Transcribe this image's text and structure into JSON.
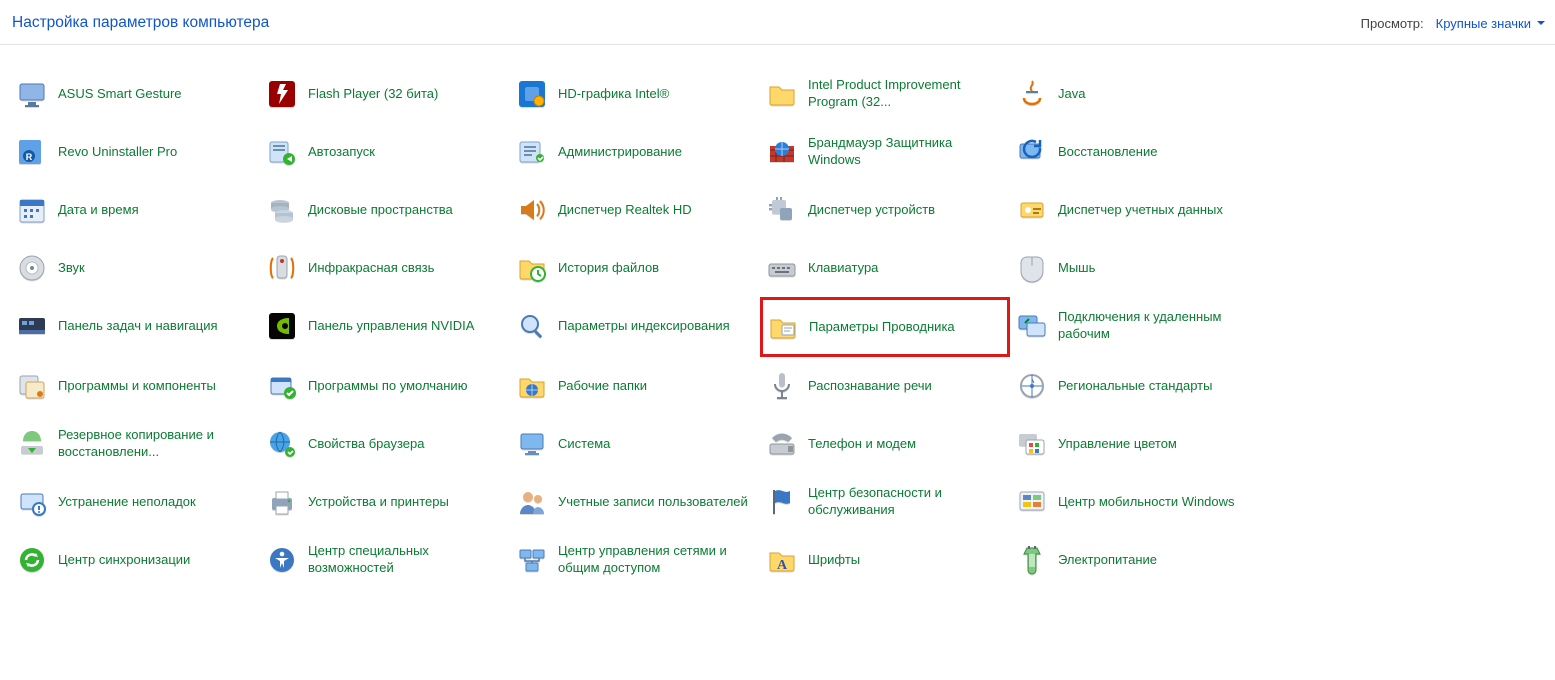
{
  "header": {
    "title": "Настройка параметров компьютера",
    "view_label": "Просмотр:",
    "view_value": "Крупные значки"
  },
  "highlight": "explorer-options",
  "items": [
    {
      "id": "asus-smart-gesture",
      "label": "ASUS Smart Gesture",
      "icon": "monitor"
    },
    {
      "id": "flash-player",
      "label": "Flash Player (32 бита)",
      "icon": "flash"
    },
    {
      "id": "hd-graphics-intel",
      "label": "HD-графика Intel®",
      "icon": "intel"
    },
    {
      "id": "intel-product-improvement",
      "label": "Intel Product Improvement Program (32...",
      "icon": "folder"
    },
    {
      "id": "java",
      "label": "Java",
      "icon": "java"
    },
    {
      "id": "revo-uninstaller",
      "label": "Revo Uninstaller Pro",
      "icon": "revo"
    },
    {
      "id": "autorun",
      "label": "Автозапуск",
      "icon": "autorun"
    },
    {
      "id": "admin-tools",
      "label": "Администрирование",
      "icon": "admin"
    },
    {
      "id": "windows-defender-firewall",
      "label": "Брандмауэр Защитника Windows",
      "icon": "firewall"
    },
    {
      "id": "recovery",
      "label": "Восстановление",
      "icon": "recovery"
    },
    {
      "id": "date-time",
      "label": "Дата и время",
      "icon": "date"
    },
    {
      "id": "storage-spaces",
      "label": "Дисковые пространства",
      "icon": "disks"
    },
    {
      "id": "realtek-hd",
      "label": "Диспетчер Realtek HD",
      "icon": "speaker"
    },
    {
      "id": "device-manager",
      "label": "Диспетчер устройств",
      "icon": "device"
    },
    {
      "id": "credential-manager",
      "label": "Диспетчер учетных данных",
      "icon": "cred"
    },
    {
      "id": "sound",
      "label": "Звук",
      "icon": "sound"
    },
    {
      "id": "infrared",
      "label": "Инфракрасная связь",
      "icon": "infrared"
    },
    {
      "id": "file-history",
      "label": "История файлов",
      "icon": "folderclock"
    },
    {
      "id": "keyboard",
      "label": "Клавиатура",
      "icon": "keyboard"
    },
    {
      "id": "mouse",
      "label": "Мышь",
      "icon": "mouse"
    },
    {
      "id": "taskbar-navigation",
      "label": "Панель задач и навигация",
      "icon": "taskbar"
    },
    {
      "id": "nvidia-panel",
      "label": "Панель управления NVIDIA",
      "icon": "nvidia"
    },
    {
      "id": "indexing-options",
      "label": "Параметры индексирования",
      "icon": "search"
    },
    {
      "id": "explorer-options",
      "label": "Параметры Проводника",
      "icon": "folderopt"
    },
    {
      "id": "remote-desktop",
      "label": "Подключения к удаленным рабочим",
      "icon": "remote"
    },
    {
      "id": "programs-features",
      "label": "Программы и компоненты",
      "icon": "programs"
    },
    {
      "id": "default-programs",
      "label": "Программы по умолчанию",
      "icon": "defapps"
    },
    {
      "id": "work-folders",
      "label": "Рабочие папки",
      "icon": "workfolders"
    },
    {
      "id": "speech-recognition",
      "label": "Распознавание речи",
      "icon": "mic"
    },
    {
      "id": "region",
      "label": "Региональные стандарты",
      "icon": "region"
    },
    {
      "id": "backup-restore",
      "label": "Резервное копирование и восстановлени...",
      "icon": "backup"
    },
    {
      "id": "internet-options",
      "label": "Свойства браузера",
      "icon": "internet"
    },
    {
      "id": "system",
      "label": "Система",
      "icon": "system"
    },
    {
      "id": "phone-modem",
      "label": "Телефон и модем",
      "icon": "phone"
    },
    {
      "id": "color-management",
      "label": "Управление цветом",
      "icon": "color"
    },
    {
      "id": "troubleshooting",
      "label": "Устранение неполадок",
      "icon": "trouble"
    },
    {
      "id": "devices-printers",
      "label": "Устройства и принтеры",
      "icon": "printers"
    },
    {
      "id": "user-accounts",
      "label": "Учетные записи пользователей",
      "icon": "users"
    },
    {
      "id": "security-maintenance",
      "label": "Центр безопасности и обслуживания",
      "icon": "flag"
    },
    {
      "id": "mobility-center",
      "label": "Центр мобильности Windows",
      "icon": "mobility"
    },
    {
      "id": "sync-center",
      "label": "Центр синхронизации",
      "icon": "sync"
    },
    {
      "id": "ease-of-access",
      "label": "Центр специальных возможностей",
      "icon": "ease"
    },
    {
      "id": "network-sharing",
      "label": "Центр управления сетями и общим доступом",
      "icon": "network"
    },
    {
      "id": "fonts",
      "label": "Шрифты",
      "icon": "fonts"
    },
    {
      "id": "power-options",
      "label": "Электропитание",
      "icon": "power"
    }
  ]
}
